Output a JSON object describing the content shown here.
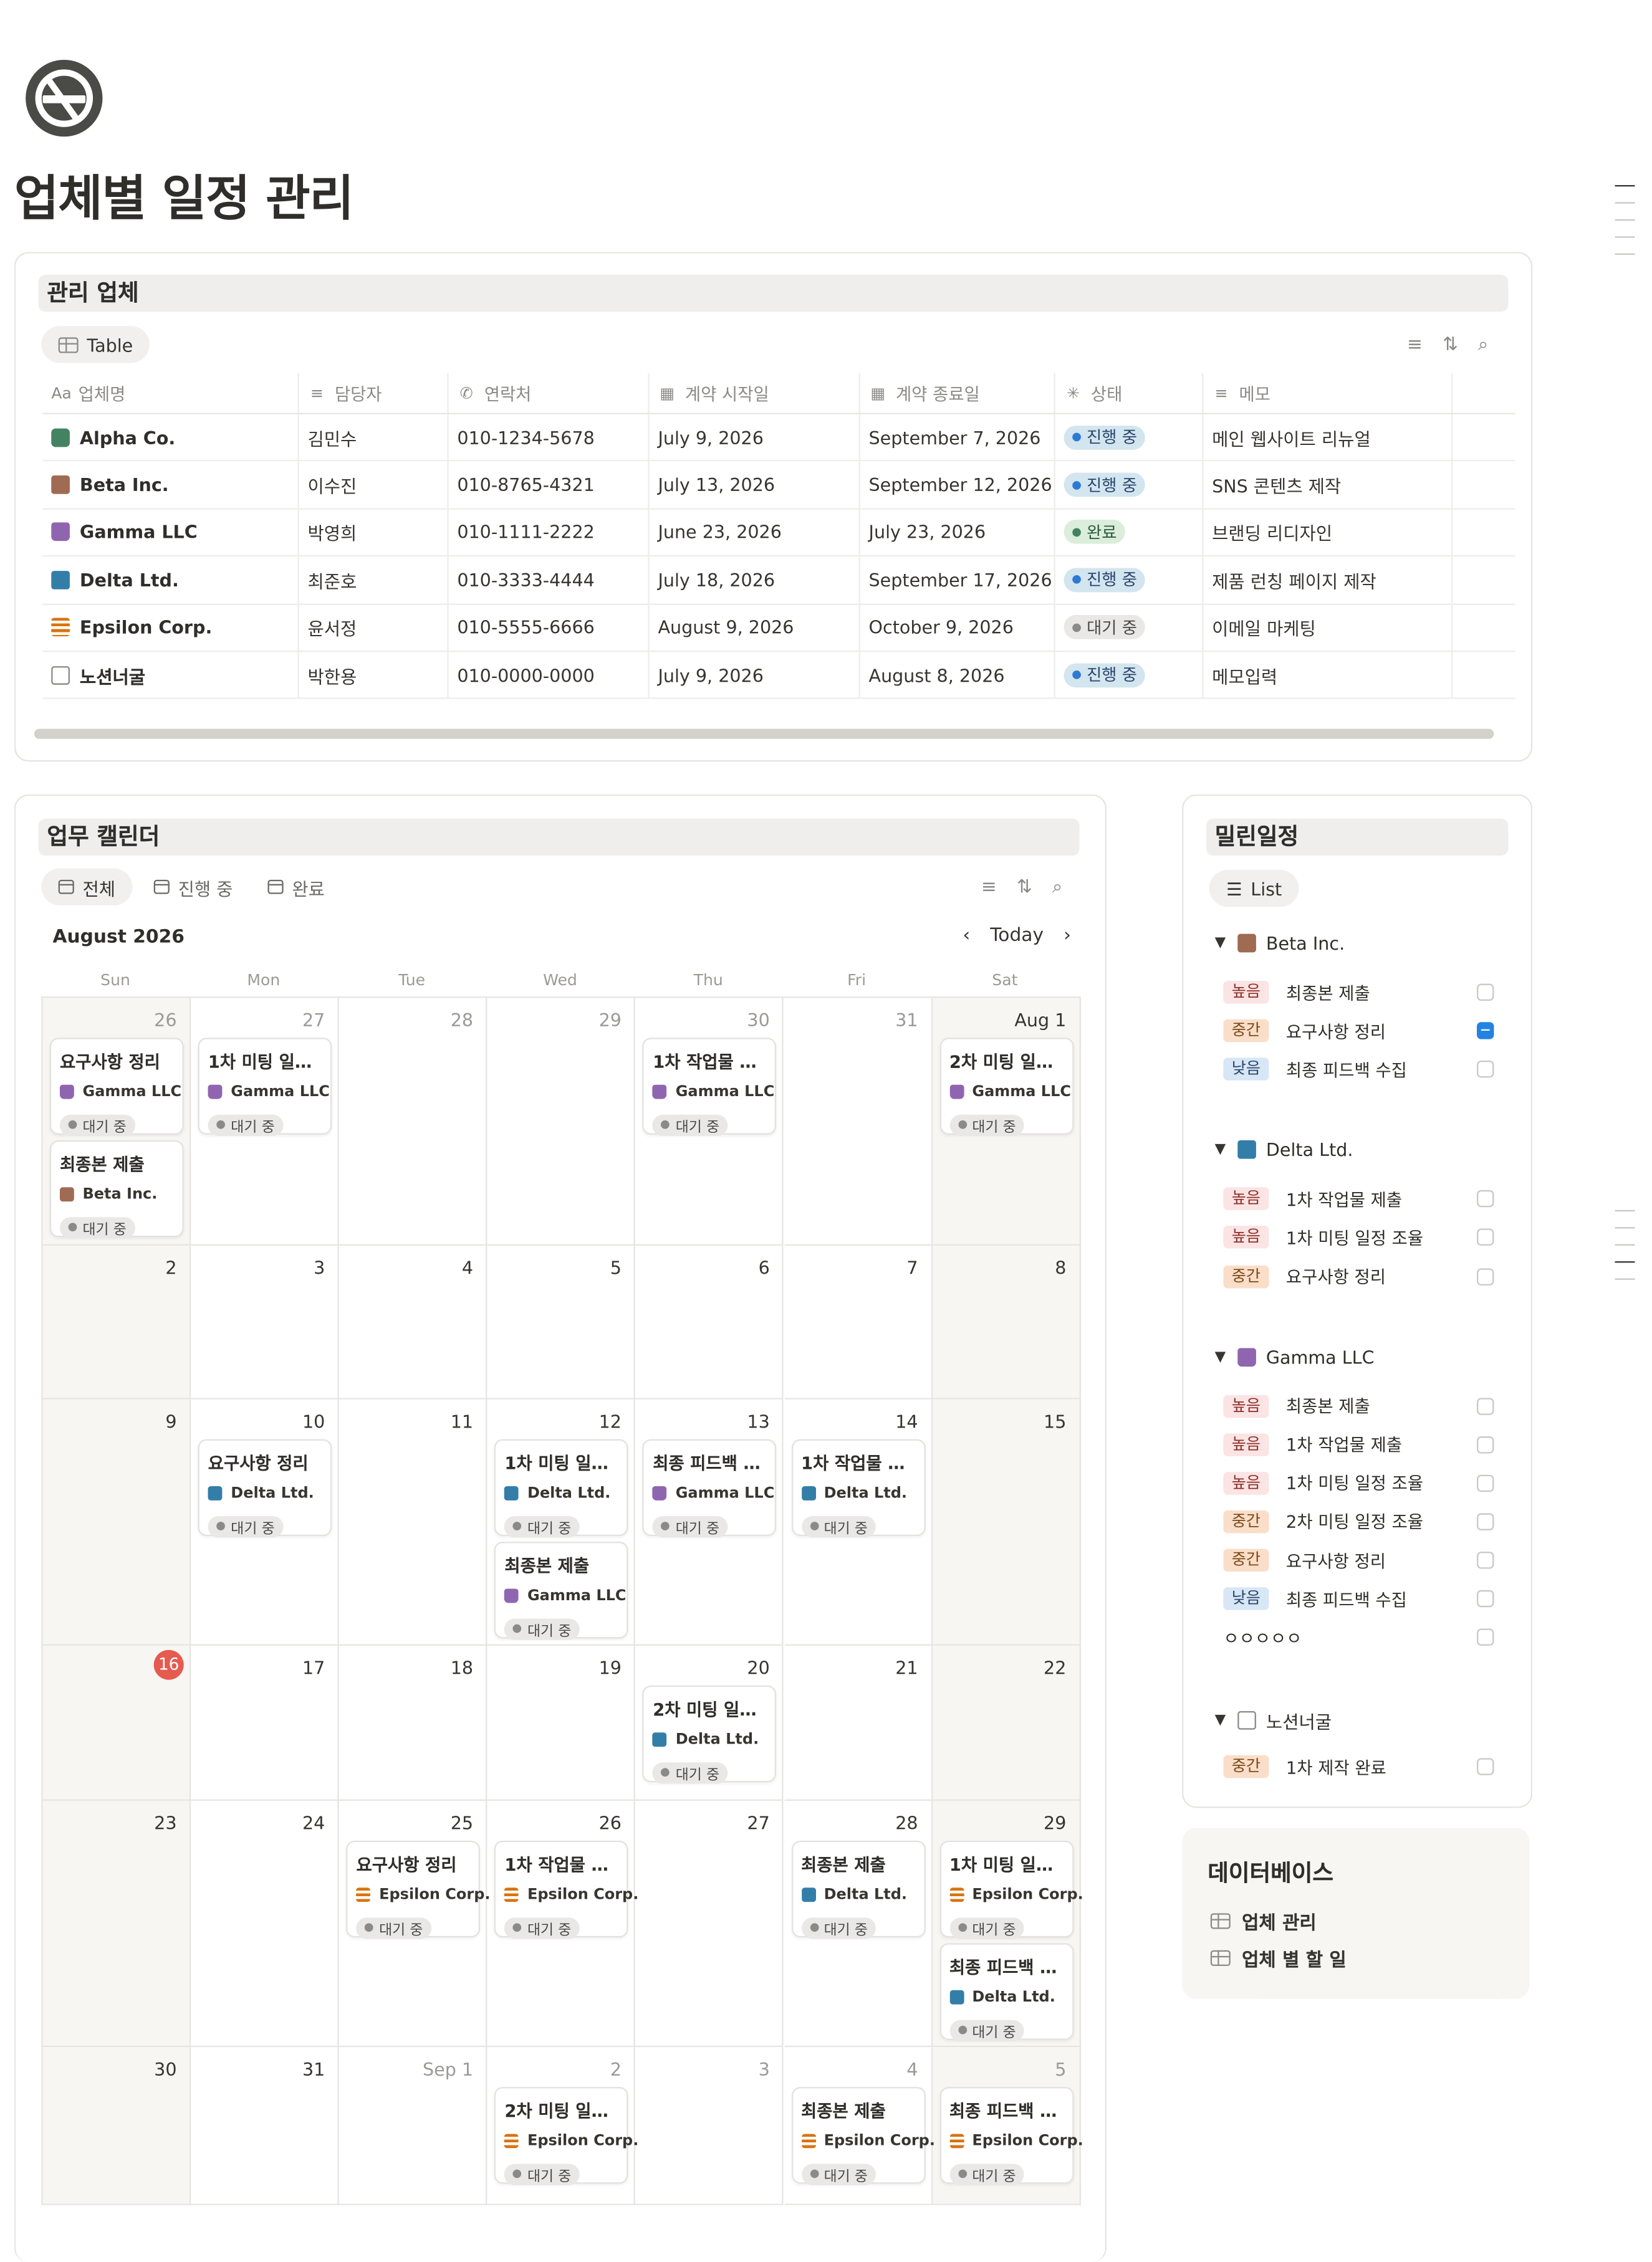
{
  "page": {
    "title": "업체별 일정 관리",
    "icon": "no-smoking-icon"
  },
  "companies_block": {
    "heading": "관리 업체",
    "view_label": "Table",
    "columns": [
      "업체명",
      "담당자",
      "연락처",
      "계약 시작일",
      "계약 종료일",
      "상태",
      "메모"
    ],
    "column_icons": [
      "Aa",
      "text-icon",
      "phone-icon",
      "calendar-icon",
      "calendar-icon",
      "status-icon",
      "text-icon"
    ],
    "rows": [
      {
        "name": "Alpha Co.",
        "icon": "gamepad-icon",
        "manager": "김민수",
        "phone": "010-1234-5678",
        "start": "July 9, 2026",
        "end": "September 7, 2026",
        "status": "진행 중",
        "memo": "메인 웹사이트 리뉴얼"
      },
      {
        "name": "Beta Inc.",
        "icon": "brick-icon",
        "manager": "이수진",
        "phone": "010-8765-4321",
        "start": "July 13, 2026",
        "end": "September 12, 2026",
        "status": "진행 중",
        "memo": "SNS 콘텐츠 제작"
      },
      {
        "name": "Gamma LLC",
        "icon": "shopping-bag-icon",
        "manager": "박영희",
        "phone": "010-1111-2222",
        "start": "June 23, 2026",
        "end": "July 23, 2026",
        "status": "완료",
        "memo": "브랜딩 리디자인"
      },
      {
        "name": "Delta Ltd.",
        "icon": "building-icon",
        "manager": "최준호",
        "phone": "010-3333-4444",
        "start": "July 18, 2026",
        "end": "September 17, 2026",
        "status": "진행 중",
        "memo": "제품 런칭 페이지 제작"
      },
      {
        "name": "Epsilon Corp.",
        "icon": "checklist-icon",
        "manager": "윤서정",
        "phone": "010-5555-6666",
        "start": "August 9, 2026",
        "end": "October 9, 2026",
        "status": "대기 중",
        "memo": "이메일 마케팅"
      },
      {
        "name": "노션너굴",
        "icon": "document-icon",
        "manager": "박한용",
        "phone": "010-0000-0000",
        "start": "July 9, 2026",
        "end": "August 8, 2026",
        "status": "진행 중",
        "memo": "메모입력"
      }
    ]
  },
  "calendar_block": {
    "heading": "업무 캘린더",
    "tabs": [
      "전체",
      "진행 중",
      "완료"
    ],
    "month": "August 2026",
    "today_label": "Today",
    "weekdays": [
      "Sun",
      "Mon",
      "Tue",
      "Wed",
      "Thu",
      "Fri",
      "Sat"
    ],
    "weeks": [
      [
        "26",
        "27",
        "28",
        "29",
        "30",
        "31",
        "Aug 1"
      ],
      [
        "2",
        "3",
        "4",
        "5",
        "6",
        "7",
        "8"
      ],
      [
        "9",
        "10",
        "11",
        "12",
        "13",
        "14",
        "15"
      ],
      [
        "16",
        "17",
        "18",
        "19",
        "20",
        "21",
        "22"
      ],
      [
        "23",
        "24",
        "25",
        "26",
        "27",
        "28",
        "29"
      ],
      [
        "30",
        "31",
        "Sep 1",
        "2",
        "3",
        "4",
        "5"
      ]
    ],
    "today": "16",
    "events": [
      {
        "week": 0,
        "day": 0,
        "slot": 0,
        "title": "요구사항 정리",
        "company": "Gamma LLC",
        "status": "대기 중"
      },
      {
        "week": 0,
        "day": 0,
        "slot": 1,
        "title": "최종본 제출",
        "company": "Beta Inc.",
        "status": "대기 중"
      },
      {
        "week": 0,
        "day": 1,
        "slot": 0,
        "title": "1차 미팅 일정 ...",
        "company": "Gamma LLC",
        "status": "대기 중"
      },
      {
        "week": 0,
        "day": 4,
        "slot": 0,
        "title": "1차 작업물 제출",
        "company": "Gamma LLC",
        "status": "대기 중"
      },
      {
        "week": 0,
        "day": 6,
        "slot": 0,
        "title": "2차 미팅 일정 ...",
        "company": "Gamma LLC",
        "status": "대기 중"
      },
      {
        "week": 2,
        "day": 1,
        "slot": 0,
        "title": "요구사항 정리",
        "company": "Delta Ltd.",
        "status": "대기 중"
      },
      {
        "week": 2,
        "day": 3,
        "slot": 0,
        "title": "1차 미팅 일정 ...",
        "company": "Delta Ltd.",
        "status": "대기 중"
      },
      {
        "week": 2,
        "day": 3,
        "slot": 1,
        "title": "최종본 제출",
        "company": "Gamma LLC",
        "status": "대기 중"
      },
      {
        "week": 2,
        "day": 4,
        "slot": 0,
        "title": "최종 피드백 수집",
        "company": "Gamma LLC",
        "status": "대기 중"
      },
      {
        "week": 2,
        "day": 5,
        "slot": 0,
        "title": "1차 작업물 제출",
        "company": "Delta Ltd.",
        "status": "대기 중"
      },
      {
        "week": 3,
        "day": 4,
        "slot": 0,
        "title": "2차 미팅 일정 ...",
        "company": "Delta Ltd.",
        "status": "대기 중"
      },
      {
        "week": 4,
        "day": 2,
        "slot": 0,
        "title": "요구사항 정리",
        "company": "Epsilon Corp.",
        "status": "대기 중"
      },
      {
        "week": 4,
        "day": 3,
        "slot": 0,
        "title": "1차 작업물 제출",
        "company": "Epsilon Corp.",
        "status": "대기 중"
      },
      {
        "week": 4,
        "day": 5,
        "slot": 0,
        "title": "최종본 제출",
        "company": "Delta Ltd.",
        "status": "대기 중"
      },
      {
        "week": 4,
        "day": 6,
        "slot": 0,
        "title": "1차 미팅 일정 ...",
        "company": "Epsilon Corp.",
        "status": "대기 중"
      },
      {
        "week": 4,
        "day": 6,
        "slot": 1,
        "title": "최종 피드백 수집",
        "company": "Delta Ltd.",
        "status": "대기 중"
      },
      {
        "week": 5,
        "day": 3,
        "slot": 0,
        "title": "2차 미팅 일정 ...",
        "company": "Epsilon Corp.",
        "status": "대기 중"
      },
      {
        "week": 5,
        "day": 5,
        "slot": 0,
        "title": "최종본 제출",
        "company": "Epsilon Corp.",
        "status": "대기 중"
      },
      {
        "week": 5,
        "day": 6,
        "slot": 0,
        "title": "최종 피드백 수집",
        "company": "Epsilon Corp.",
        "status": "대기 중"
      }
    ]
  },
  "overdue_block": {
    "heading": "밀린일정",
    "view_label": "List",
    "groups": [
      {
        "company": "Beta Inc.",
        "items": [
          {
            "priority": "높음",
            "task": "최종본 제출",
            "checked": false
          },
          {
            "priority": "중간",
            "task": "요구사항 정리",
            "checked": true
          },
          {
            "priority": "낮음",
            "task": "최종 피드백 수집",
            "checked": false
          }
        ]
      },
      {
        "company": "Delta Ltd.",
        "items": [
          {
            "priority": "높음",
            "task": "1차 작업물 제출",
            "checked": false
          },
          {
            "priority": "높음",
            "task": "1차 미팅 일정 조율",
            "checked": false
          },
          {
            "priority": "중간",
            "task": "요구사항 정리",
            "checked": false
          }
        ]
      },
      {
        "company": "Gamma LLC",
        "items": [
          {
            "priority": "높음",
            "task": "최종본 제출",
            "checked": false
          },
          {
            "priority": "높음",
            "task": "1차 작업물 제출",
            "checked": false
          },
          {
            "priority": "높음",
            "task": "1차 미팅 일정 조율",
            "checked": false
          },
          {
            "priority": "중간",
            "task": "2차 미팅 일정 조율",
            "checked": false
          },
          {
            "priority": "중간",
            "task": "요구사항 정리",
            "checked": false
          },
          {
            "priority": "낮음",
            "task": "최종 피드백 수집",
            "checked": false
          },
          {
            "priority": "",
            "task": "ㅇㅇㅇㅇㅇ",
            "checked": false
          }
        ]
      },
      {
        "company": "노션너굴",
        "items": [
          {
            "priority": "중간",
            "task": "1차 제작 완료",
            "checked": false
          }
        ]
      }
    ]
  },
  "database_block": {
    "heading": "데이터베이스",
    "items": [
      "업체 관리",
      "업체 별 할 일"
    ]
  },
  "colors": {
    "status_in_progress": "#2d7ad6",
    "status_done": "#448361",
    "status_waiting": "#8b8a86",
    "today": "#e55b4f",
    "checkbox_checked": "#2383e2",
    "priority_high_bg": "#fbe4e4",
    "priority_mid_bg": "#fadec9",
    "priority_low_bg": "#d8e7f5"
  }
}
